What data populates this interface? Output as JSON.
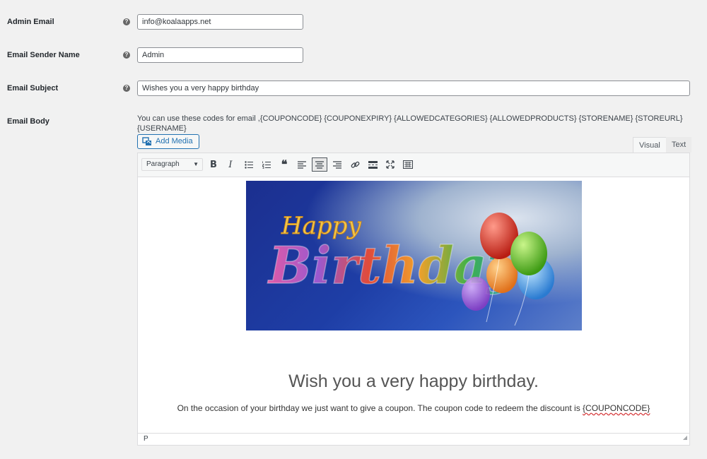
{
  "fields": {
    "admin_email": {
      "label": "Admin Email",
      "value": "info@koalaapps.net"
    },
    "sender_name": {
      "label": "Email Sender Name",
      "value": "Admin"
    },
    "subject": {
      "label": "Email Subject",
      "value": "Wishes you a very happy birthday"
    },
    "body": {
      "label": "Email Body"
    }
  },
  "help_icon_glyph": "?",
  "codes_hint": "You can use these codes for email ,{COUPONCODE} {COUPONEXPIRY} {ALLOWEDCATEGORIES} {ALLOWEDPRODUCTS} {STORENAME} {STOREURL} {USERNAME}",
  "editor": {
    "add_media_label": "Add Media",
    "tabs": {
      "visual": "Visual",
      "text": "Text"
    },
    "format_select": "Paragraph",
    "toolbar_icons": [
      "bold-icon",
      "italic-icon",
      "bullet-list-icon",
      "numbered-list-icon",
      "blockquote-icon",
      "align-left-icon",
      "align-center-icon",
      "align-right-icon",
      "link-icon",
      "read-more-icon",
      "fullscreen-icon",
      "toolbar-toggle-icon"
    ],
    "banner": {
      "word1": "Happy",
      "word2": "Birthday"
    },
    "greeting": "Wish you a very happy birthday.",
    "body_text": "On the occasion of your birthday we just want to give a coupon. The coupon code to redeem the discount is ",
    "body_code": "{COUPONCODE}",
    "status_path": "P"
  },
  "colors": {
    "accent": "#2271b1",
    "background": "#f1f1f1"
  }
}
